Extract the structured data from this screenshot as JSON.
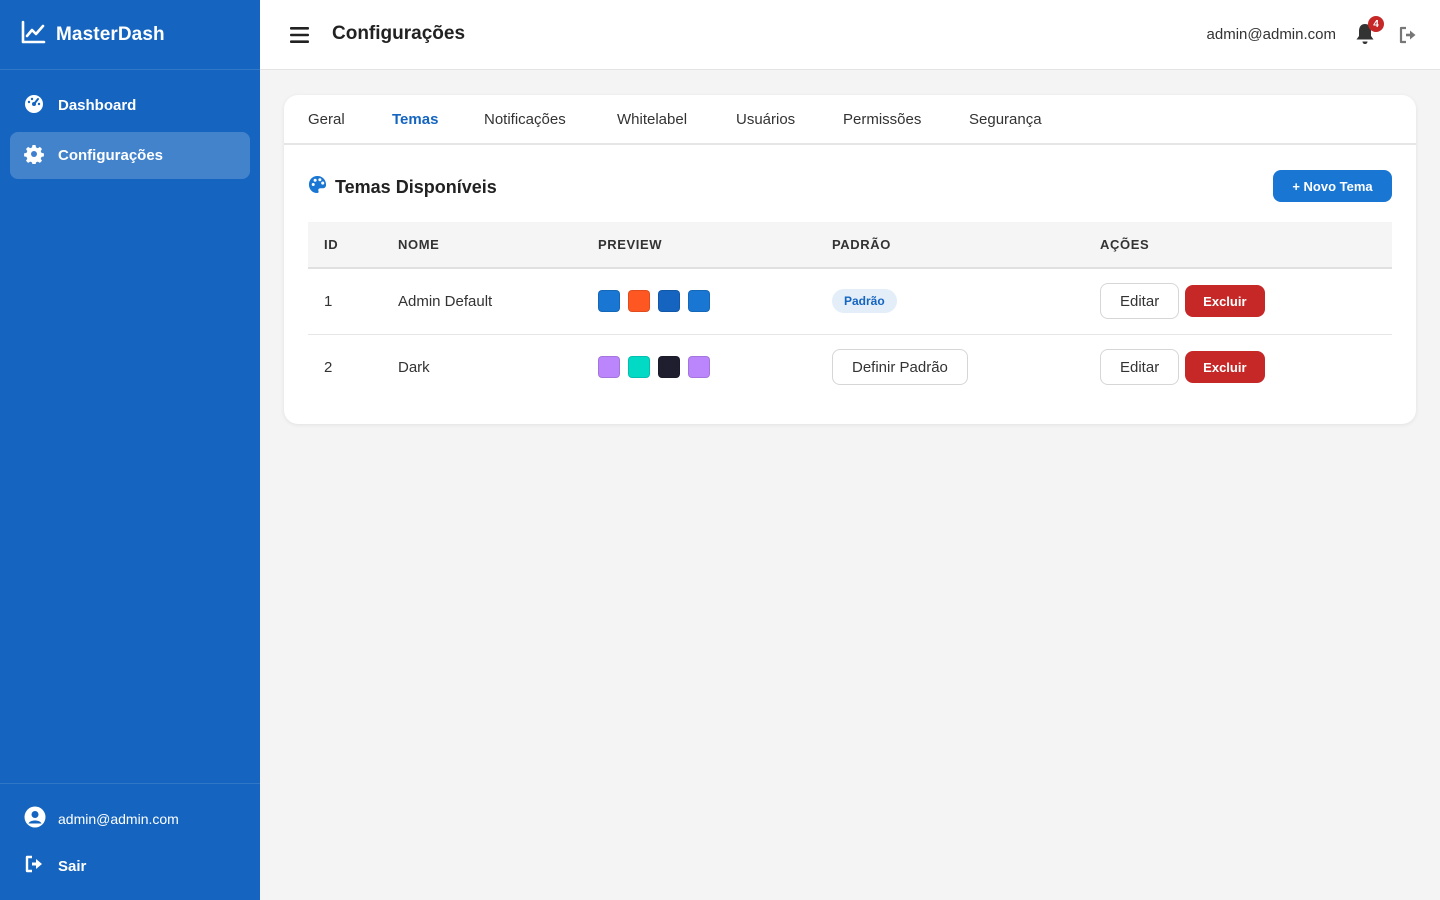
{
  "sidebar": {
    "brand": "MasterDash",
    "items": [
      {
        "label": "Dashboard",
        "icon": "palette-gauge-icon"
      },
      {
        "label": "Configurações",
        "icon": "gear-icon"
      }
    ],
    "user_email": "admin@admin.com",
    "logout_label": "Sair"
  },
  "topbar": {
    "title": "Configurações",
    "email": "admin@admin.com",
    "notification_count": "4"
  },
  "tabs": [
    "Geral",
    "Temas",
    "Notificações",
    "Whitelabel",
    "Usuários",
    "Permissões",
    "Segurança"
  ],
  "active_tab": "Temas",
  "section": {
    "title": "Temas Disponíveis",
    "new_button": "+ Novo Tema"
  },
  "table": {
    "headers": [
      "ID",
      "NOME",
      "PREVIEW",
      "PADRÃO",
      "AÇÕES"
    ],
    "rows": [
      {
        "id": "1",
        "name": "Admin Default",
        "colors": [
          "#1976d2",
          "#ff5722",
          "#1565c0",
          "#1976d2"
        ],
        "default_label": "Padrão",
        "edit": "Editar",
        "delete": "Excluir"
      },
      {
        "id": "2",
        "name": "Dark",
        "colors": [
          "#bb86fc",
          "#03dac6",
          "#1e1e2f",
          "#bb86fc"
        ],
        "set_default": "Definir Padrão",
        "edit": "Editar",
        "delete": "Excluir"
      }
    ]
  },
  "colors": {
    "primary": "#1565c0",
    "accent": "#1976d2",
    "danger": "#c62828"
  }
}
